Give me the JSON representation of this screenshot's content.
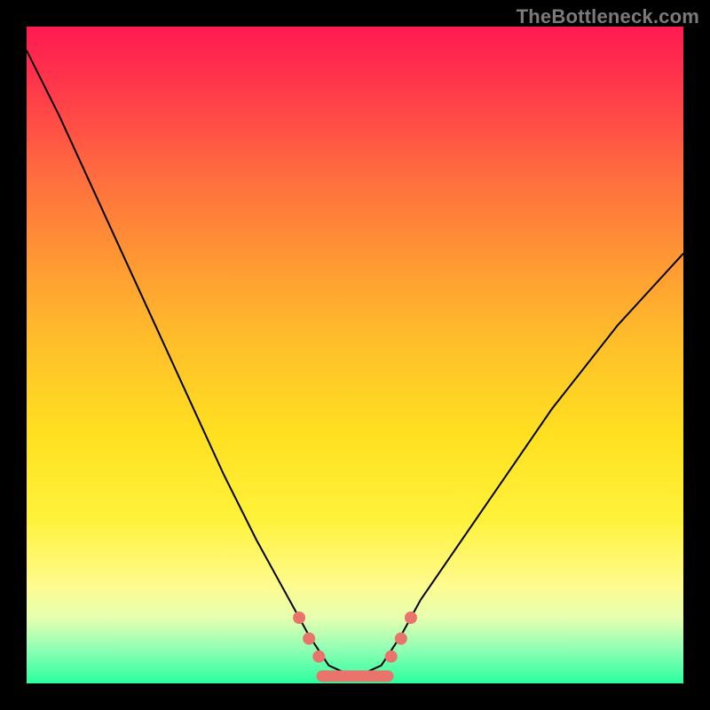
{
  "attribution": "TheBottleneck.com",
  "colors": {
    "background": "#000000",
    "gradient_top": "#ff1a50",
    "gradient_bottom": "#2bff9e",
    "curve": "#000000",
    "marker": "#e8746b"
  },
  "chart_data": {
    "type": "line",
    "title": "",
    "xlabel": "",
    "ylabel": "",
    "xlim": [
      0,
      100
    ],
    "ylim": [
      0,
      100
    ],
    "grid": false,
    "series": [
      {
        "name": "bottleneck-curve",
        "x": [
          0,
          5,
          10,
          15,
          20,
          25,
          30,
          35,
          40,
          43,
          46,
          50,
          54,
          57,
          60,
          65,
          70,
          75,
          80,
          85,
          90,
          95,
          100
        ],
        "y": [
          106,
          95,
          83,
          71,
          59,
          47,
          35,
          24,
          14,
          8,
          3,
          1,
          3,
          8,
          14,
          22,
          30,
          38,
          46,
          53,
          60,
          66,
          72
        ]
      }
    ],
    "markers": {
      "name": "basin-dots",
      "points": [
        {
          "x": 41.5,
          "y": 11
        },
        {
          "x": 43.0,
          "y": 7.5
        },
        {
          "x": 44.5,
          "y": 4.5
        },
        {
          "x": 55.5,
          "y": 4.5
        },
        {
          "x": 57.0,
          "y": 7.5
        },
        {
          "x": 58.5,
          "y": 11
        }
      ],
      "basin_segment": {
        "x0": 45,
        "x1": 55,
        "y": 1.2
      }
    }
  }
}
